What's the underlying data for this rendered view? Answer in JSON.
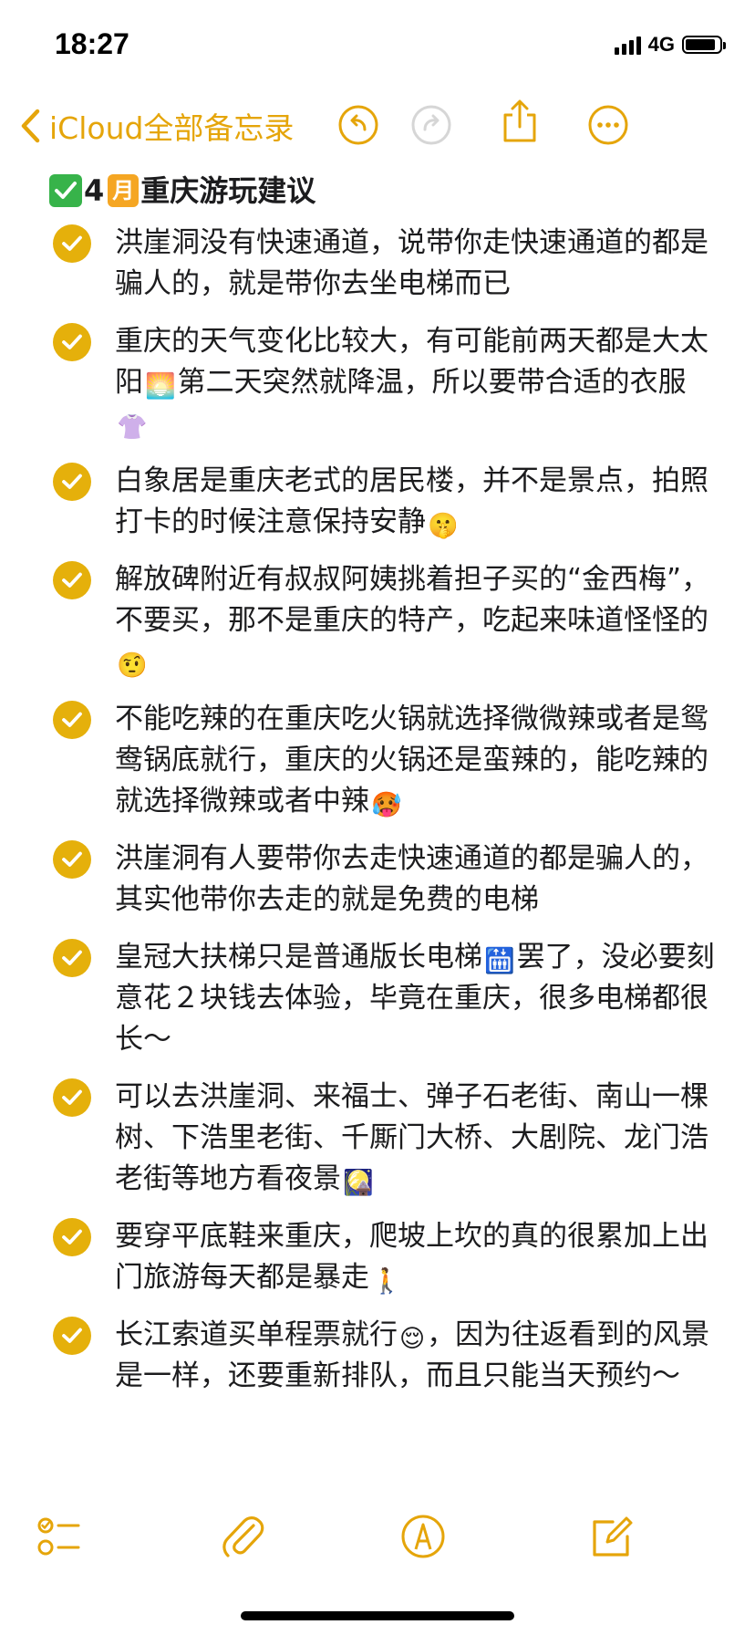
{
  "status_bar": {
    "time": "18:27",
    "network": "4G",
    "battery_level": 0.9
  },
  "nav": {
    "back_label": "iCloud全部备忘录",
    "accent_color": "#e5a50a",
    "icons": [
      "chevron-left-icon",
      "undo-icon",
      "redo-icon",
      "share-icon",
      "more-icon"
    ]
  },
  "note": {
    "title_prefix": "4",
    "title_month": "月",
    "title_text": "重庆游玩建议",
    "check_color": "#e5b00b",
    "items": [
      {
        "text": "洪崖洞没有快速通道，说带你走快速通道的都是骗人的，就是带你去坐电梯而已",
        "emoji": "",
        "after": ""
      },
      {
        "text": "重庆的天气变化比较大，有可能前两天都是大太阳",
        "emoji": "🌅",
        "after": "第二天突然就降温，所以要带合适的衣服",
        "emoji2": "👚"
      },
      {
        "text": "白象居是重庆老式的居民楼，并不是景点，拍照打卡的时候注意保持安静",
        "emoji": "🤫",
        "after": ""
      },
      {
        "text": "解放碑附近有叔叔阿姨挑着担子买的“金西梅”，不要买，那不是重庆的特产，吃起来味道怪怪的",
        "emoji": "🤨",
        "after": ""
      },
      {
        "text": "不能吃辣的在重庆吃火锅就选择微微辣或者是鸳鸯锅底就行，重庆的火锅还是蛮辣的，能吃辣的就选择微辣或者中辣",
        "emoji": "🥵",
        "after": ""
      },
      {
        "text": "洪崖洞有人要带你去走快速通道的都是骗人的，其实他带你去走的就是免费的电梯",
        "emoji": "",
        "after": ""
      },
      {
        "text": "皇冠大扶梯只是普通版长电梯",
        "emoji": "🛗",
        "after": "罢了，没必要刻意花２块钱去体验，毕竟在重庆，很多电梯都很长～"
      },
      {
        "text": "可以去洪崖洞、来福士、弹子石老街、南山一棵树、下浩里老街、千厮门大桥、大剧院、龙门浩老街等地方看夜景",
        "emoji": "🎑",
        "after": ""
      },
      {
        "text": "要穿平底鞋来重庆，爬坡上坎的真的很累加上出门旅游每天都是暴走",
        "emoji": "🚶",
        "after": ""
      },
      {
        "text": "长江索道买单程票就行",
        "emoji": "😌",
        "after": "，因为往返看到的风景是一样，还要重新排队，而且只能当天预约～"
      }
    ]
  },
  "toolbar": {
    "icons": [
      "checklist-icon",
      "attachment-icon",
      "markup-icon",
      "compose-icon"
    ]
  }
}
